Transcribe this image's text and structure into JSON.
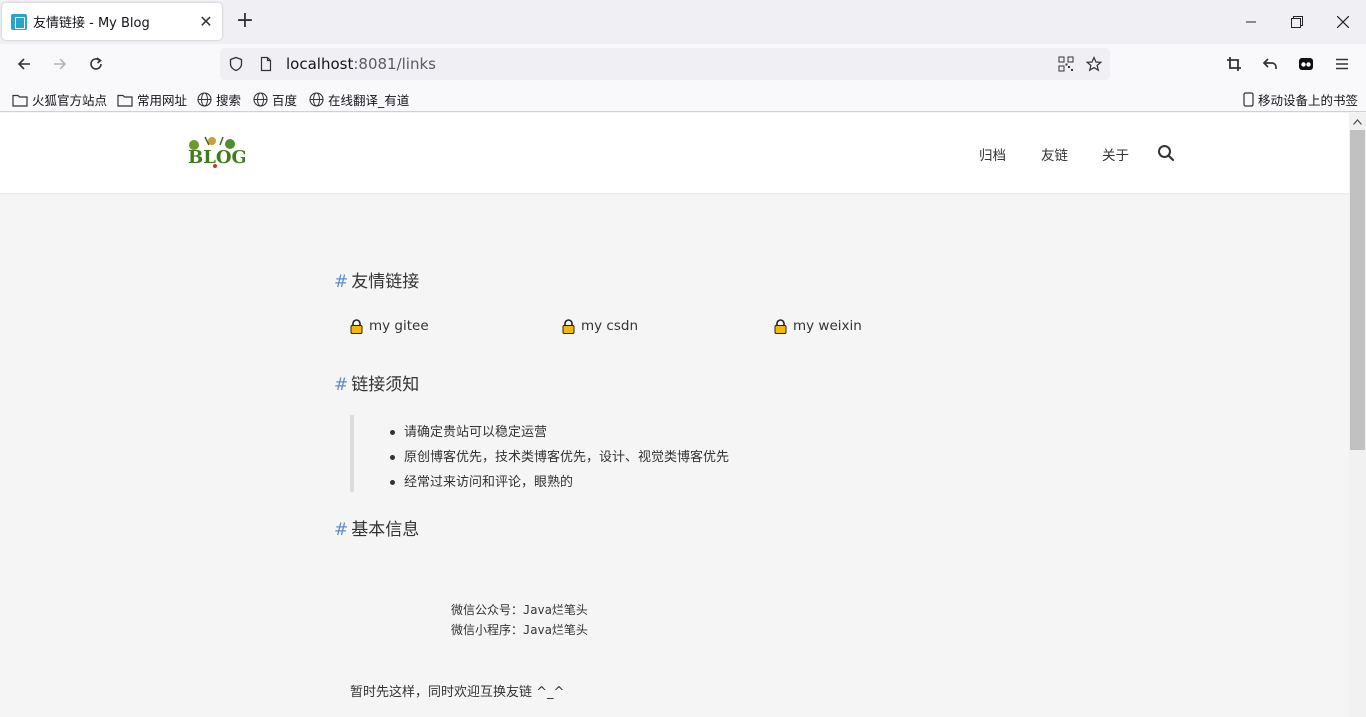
{
  "browser": {
    "tab_title": "友情链接 - My Blog",
    "url_host": "localhost",
    "url_rest": ":8081/links",
    "bookmarks": [
      {
        "label": "火狐官方站点",
        "icon": "folder-icon"
      },
      {
        "label": "常用网址",
        "icon": "folder-icon"
      },
      {
        "label": "搜索",
        "icon": "globe-icon"
      },
      {
        "label": "百度",
        "icon": "globe-icon"
      },
      {
        "label": "在线翻译_有道",
        "icon": "globe-icon"
      }
    ],
    "mobile_bookmarks": "移动设备上的书签"
  },
  "site": {
    "logo_text": "BLOG",
    "nav": [
      "归档",
      "友链",
      "关于"
    ]
  },
  "content": {
    "section_friends": "友情链接",
    "friends": [
      "my gitee",
      "my csdn",
      "my weixin"
    ],
    "section_rules": "链接须知",
    "rules": [
      "请确定贵站可以稳定运营",
      "原创博客优先，技术类博客优先，设计、视觉类博客优先",
      "经常过来访问和评论，眼熟的"
    ],
    "section_info": "基本信息",
    "info_lines": [
      "微信公众号：Java烂笔头",
      "微信小程序：Java烂笔头"
    ],
    "footer_note": "暂时先这样，同时欢迎互换友链 ^_^"
  },
  "colors": {
    "hash_accent": "#5c8ecb",
    "lock_fill": "#f5b800"
  }
}
